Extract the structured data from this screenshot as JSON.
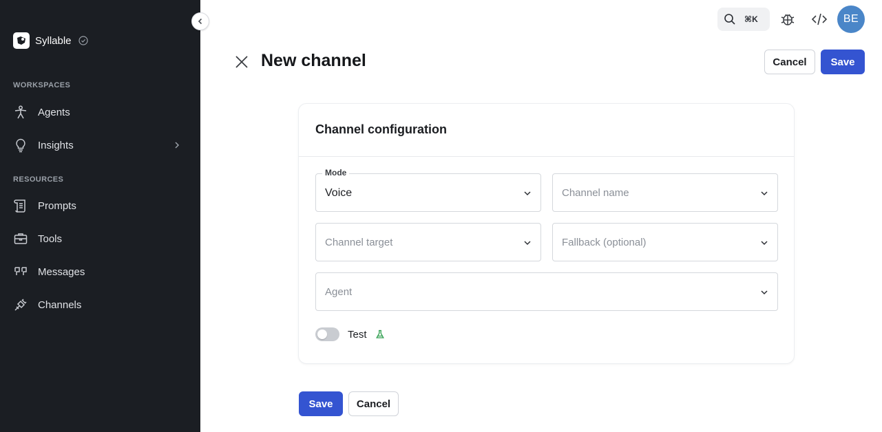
{
  "sidebar": {
    "brand": "Syllable",
    "sections": {
      "workspaces": "WORKSPACES",
      "resources": "RESOURCES"
    },
    "items": [
      {
        "label": "Agents",
        "icon": "agent-icon"
      },
      {
        "label": "Insights",
        "icon": "lightbulb-icon"
      },
      {
        "label": "Prompts",
        "icon": "scroll-icon"
      },
      {
        "label": "Tools",
        "icon": "briefcase-icon"
      },
      {
        "label": "Messages",
        "icon": "quote-icon"
      },
      {
        "label": "Channels",
        "icon": "plug-icon"
      }
    ]
  },
  "toolbar": {
    "shortcut": "⌘K",
    "avatar_initials": "BE"
  },
  "header": {
    "title": "New channel",
    "cancel_label": "Cancel",
    "save_label": "Save"
  },
  "card": {
    "title": "Channel configuration",
    "mode": {
      "label": "Mode",
      "value": "Voice"
    },
    "channel_name": {
      "placeholder": "Channel name"
    },
    "channel_target": {
      "placeholder": "Channel target"
    },
    "fallback": {
      "placeholder": "Fallback (optional)"
    },
    "agent": {
      "placeholder": "Agent"
    },
    "test_toggle": {
      "label": "Test",
      "on": false
    }
  },
  "footer": {
    "save_label": "Save",
    "cancel_label": "Cancel"
  },
  "colors": {
    "sidebar_bg": "#1b1e23",
    "primary": "#3454d1",
    "avatar": "#4a86c8",
    "flask": "#2e9e4e"
  }
}
